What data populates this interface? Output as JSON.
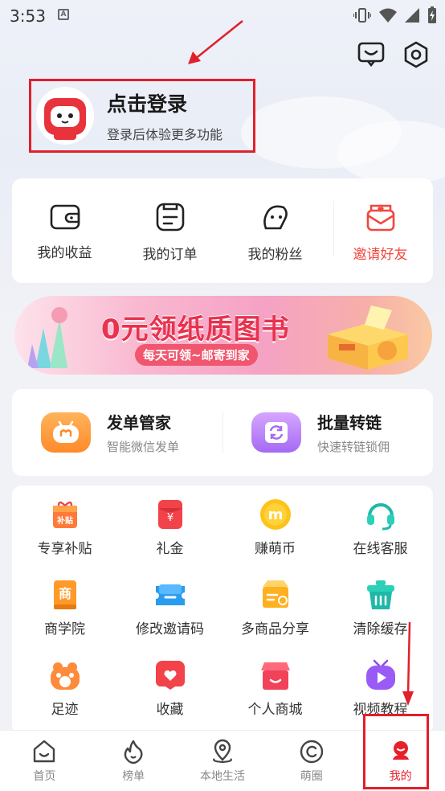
{
  "status_bar": {
    "time": "3:53",
    "a_badge": "A"
  },
  "profile": {
    "title": "点击登录",
    "subtitle": "登录后体验更多功能"
  },
  "quick_actions": [
    {
      "label": "我的收益",
      "icon": "wallet-icon"
    },
    {
      "label": "我的订单",
      "icon": "order-icon"
    },
    {
      "label": "我的粉丝",
      "icon": "fans-icon"
    },
    {
      "label": "邀请好友",
      "icon": "invite-envelope-icon"
    }
  ],
  "banner": {
    "title": "0元领纸质图书",
    "subtitle": "每天可领~邮寄到家"
  },
  "tools": [
    {
      "title": "发单管家",
      "subtitle": "智能微信发单",
      "icon": "robot-icon"
    },
    {
      "title": "批量转链",
      "subtitle": "快速转链锁佣",
      "icon": "convert-icon"
    }
  ],
  "grid": [
    {
      "label": "专享补贴",
      "icon": "subsidy-icon",
      "badge": "补贴"
    },
    {
      "label": "礼金",
      "icon": "red-envelope-icon",
      "badge": "¥"
    },
    {
      "label": "赚萌币",
      "icon": "coin-icon",
      "badge": "m"
    },
    {
      "label": "在线客服",
      "icon": "headset-icon"
    },
    {
      "label": "商学院",
      "icon": "book-icon",
      "badge": "商"
    },
    {
      "label": "修改邀请码",
      "icon": "ticket-icon"
    },
    {
      "label": "多商品分享",
      "icon": "box-share-icon"
    },
    {
      "label": "清除缓存",
      "icon": "trash-icon"
    },
    {
      "label": "足迹",
      "icon": "paw-icon"
    },
    {
      "label": "收藏",
      "icon": "heart-icon"
    },
    {
      "label": "个人商城",
      "icon": "shop-icon"
    },
    {
      "label": "视频教程",
      "icon": "video-icon"
    }
  ],
  "bottom_nav": [
    {
      "label": "首页",
      "icon": "home-icon",
      "active": false
    },
    {
      "label": "榜单",
      "icon": "flame-icon",
      "active": false
    },
    {
      "label": "本地生活",
      "icon": "location-icon",
      "active": false
    },
    {
      "label": "萌圈",
      "icon": "circle-icon",
      "active": false
    },
    {
      "label": "我的",
      "icon": "profile-icon",
      "active": true
    }
  ],
  "colors": {
    "accent_red": "#e8202a",
    "invite_red": "#f0473f",
    "banner_pink": "#e8324e"
  }
}
